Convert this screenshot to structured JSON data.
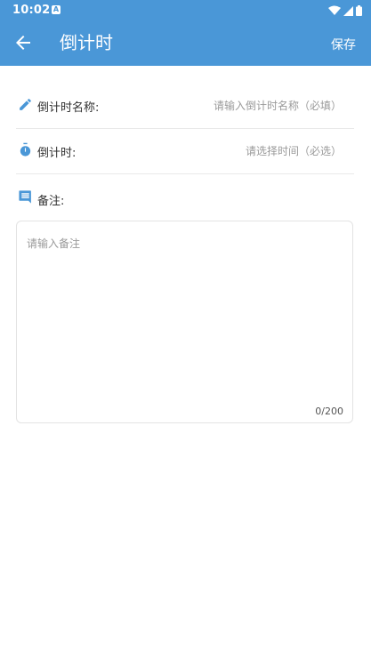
{
  "status_bar": {
    "time": "10:02",
    "notification_badge": "A"
  },
  "app_bar": {
    "title": "倒计时",
    "save_label": "保存",
    "color": "#4a97d7"
  },
  "form": {
    "name_field": {
      "label": "倒计时名称:",
      "placeholder": "请输入倒计时名称（必填）",
      "icon": "pencil-icon"
    },
    "time_field": {
      "label": "倒计时:",
      "placeholder": "请选择时间（必选）",
      "icon": "timer-icon"
    },
    "note_field": {
      "label": "备注:",
      "placeholder": "请输入备注",
      "counter": "0/200",
      "icon": "comment-icon"
    }
  }
}
